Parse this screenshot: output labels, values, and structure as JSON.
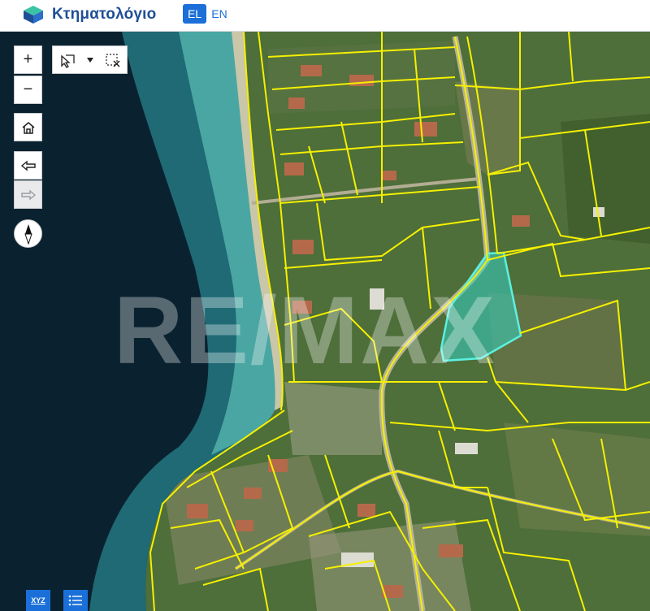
{
  "header": {
    "brand": "Κτηματολόγιο",
    "languages": [
      {
        "code": "EL",
        "active": true
      },
      {
        "code": "EN",
        "active": false
      }
    ]
  },
  "toolbar": {
    "zoom_in": "+",
    "zoom_out": "−",
    "home_icon": "home-icon",
    "back_icon": "arrow-left-icon",
    "forward_icon": "arrow-right-icon",
    "compass_icon": "compass-icon",
    "select_icon": "pointer-select-icon",
    "clear_icon": "clear-selection-icon"
  },
  "bottom_controls": {
    "coordinates_label": "XYZ",
    "layers_icon": "list-icon"
  },
  "watermark": "RE/MAX",
  "colors": {
    "brand": "#1f4e96",
    "accent": "#1b6fd8",
    "parcel_border": "#f5f000",
    "selected_parcel": "#34d4c4",
    "sea_deep": "#0a2230",
    "sea_shallow": "#3fa6a6"
  }
}
